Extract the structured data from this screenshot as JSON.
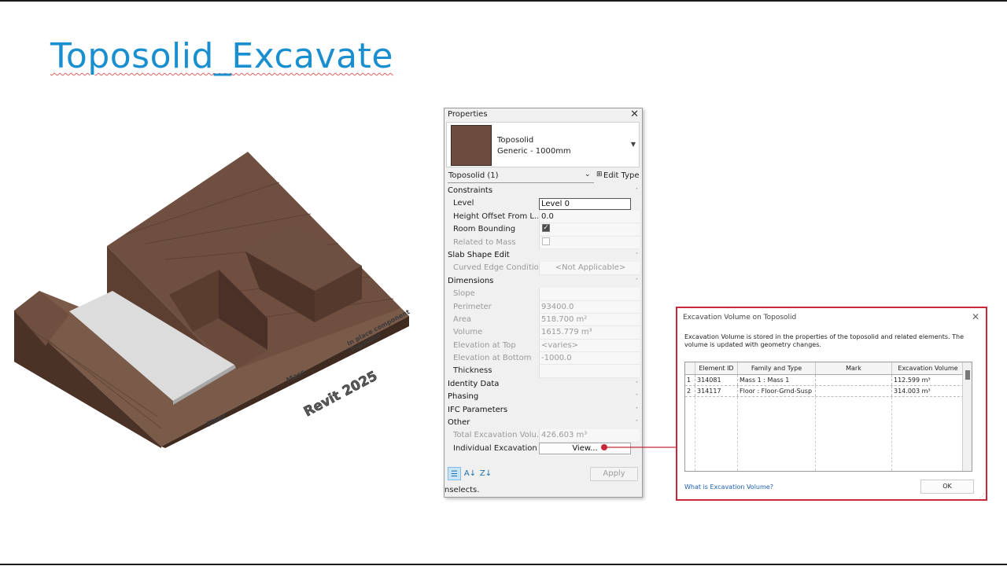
{
  "slide": {
    "title": "Toposolid_Excavate"
  },
  "model": {
    "labels": {
      "floor": "Floor",
      "mass": "Mass",
      "in_place_1": "In place component",
      "in_place_2": "Toposolid",
      "revit": "Revit 2025"
    },
    "colors": {
      "top": "#6f4f40",
      "side": "#5a3d30",
      "front": "#4b3227",
      "slab": "#d9d9d9"
    }
  },
  "properties": {
    "header": "Properties",
    "type_name": "Toposolid",
    "type_sub": "Generic - 1000mm",
    "selection": "Toposolid (1)",
    "edit_type": "Edit Type",
    "categories": {
      "constraints": "Constraints",
      "slab_shape_edit": "Slab Shape Edit",
      "dimensions": "Dimensions",
      "identity_data": "Identity Data",
      "phasing": "Phasing",
      "ifc_parameters": "IFC Parameters",
      "other": "Other"
    },
    "rows": {
      "level": {
        "name": "Level",
        "value": "Level 0"
      },
      "height_offset": {
        "name": "Height Offset From L...",
        "value": "0.0"
      },
      "room_bounding": {
        "name": "Room Bounding"
      },
      "related_to_mass": {
        "name": "Related to Mass"
      },
      "curved_edge": {
        "name": "Curved Edge Condition",
        "value": "<Not Applicable>"
      },
      "slope": {
        "name": "Slope",
        "value": ""
      },
      "perimeter": {
        "name": "Perimeter",
        "value": "93400.0"
      },
      "area": {
        "name": "Area",
        "value": "518.700 m²"
      },
      "volume": {
        "name": "Volume",
        "value": "1615.779 m³"
      },
      "elev_top": {
        "name": "Elevation at Top",
        "value": "<varies>"
      },
      "elev_bottom": {
        "name": "Elevation at Bottom",
        "value": "-1000.0"
      },
      "thickness": {
        "name": "Thickness",
        "value": ""
      },
      "total_excavation": {
        "name": "Total Excavation Volu...",
        "value": "426.603 m³"
      },
      "individual_excavation": {
        "name": "Individual Excavation ...",
        "button": "View..."
      }
    },
    "apply": "Apply",
    "status": "nselects."
  },
  "dialog": {
    "title": "Excavation Volume on Toposolid",
    "description": "Excavation Volume is stored in the properties of the toposolid and related elements. The volume is updated with geometry changes.",
    "columns": [
      "Element ID",
      "Family and Type",
      "Mark",
      "Excavation Volume"
    ],
    "rows": [
      {
        "n": "1",
        "id": "314081",
        "family": "Mass 1 : Mass 1",
        "mark": "",
        "volume": "112.599 m³"
      },
      {
        "n": "2",
        "id": "314117",
        "family": "Floor : Floor-Grnd-Susp",
        "mark": "",
        "volume": "314.003 m³"
      }
    ],
    "help_link": "What is Excavation Volume?",
    "ok": "OK"
  }
}
